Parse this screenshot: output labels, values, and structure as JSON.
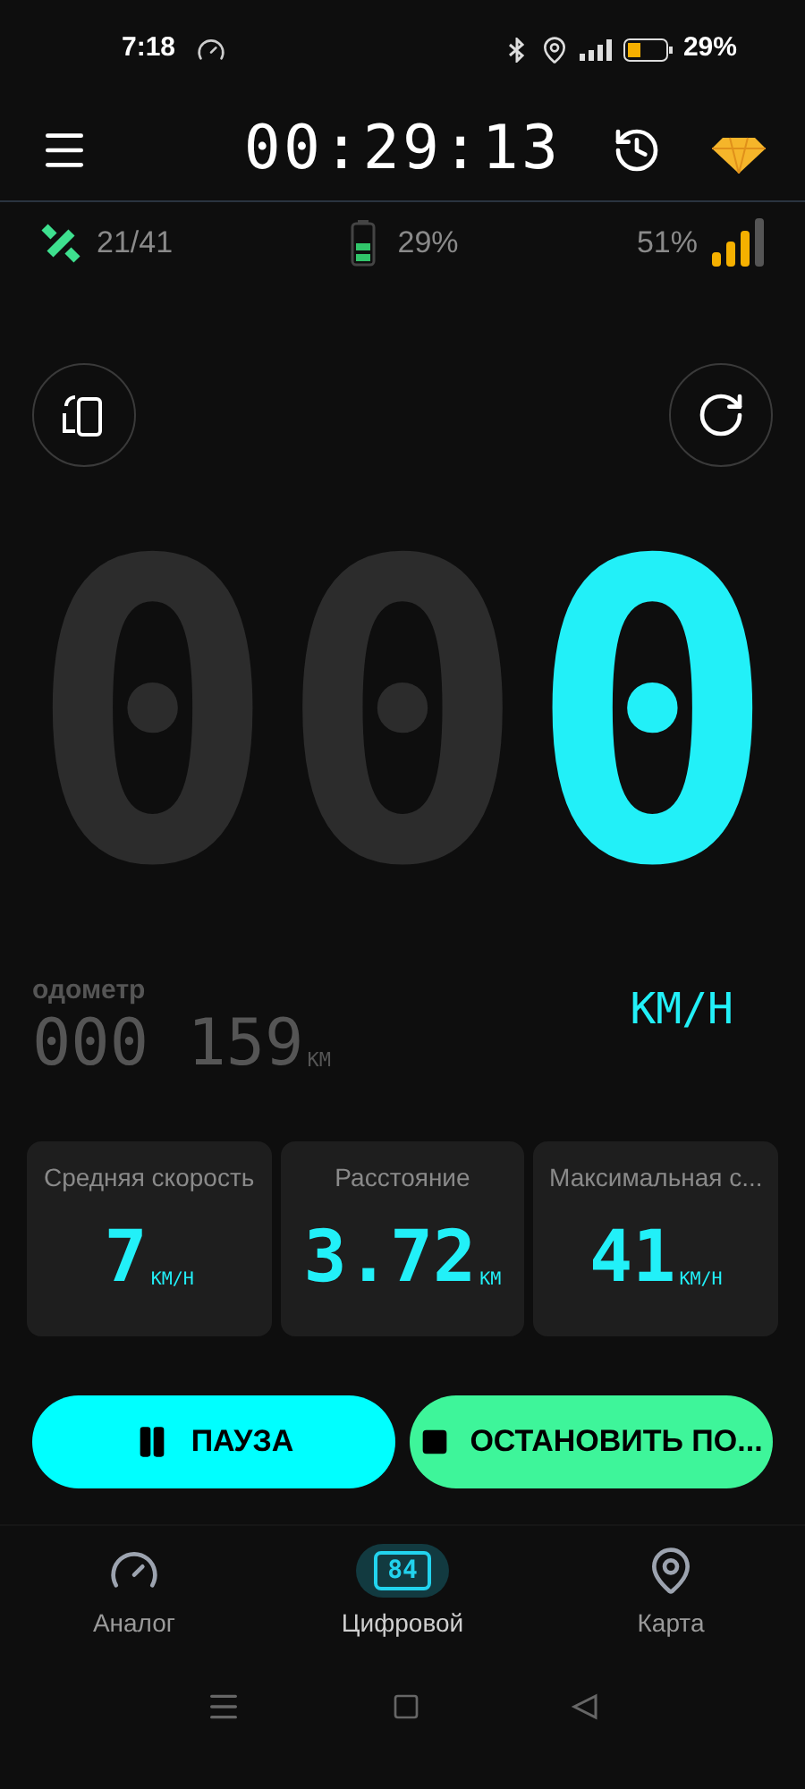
{
  "status_bar": {
    "time": "7:18",
    "battery": "29%"
  },
  "header": {
    "timer": "00:29:13"
  },
  "info": {
    "satellites": "21/41",
    "battery": "29%",
    "signal": "51%"
  },
  "speed": {
    "digits": [
      {
        "digit": "0",
        "lit": false
      },
      {
        "digit": "0",
        "lit": false
      },
      {
        "digit": "0",
        "lit": true
      }
    ],
    "unit": "KM/H"
  },
  "odometer": {
    "label": "одометр",
    "value": "000 159",
    "unit": "KM"
  },
  "stats": [
    {
      "label": "Средняя скорость",
      "value": "7",
      "unit": "KM/H"
    },
    {
      "label": "Расстояние",
      "value": "3.72",
      "unit": "KM"
    },
    {
      "label": "Максимальная с...",
      "value": "41",
      "unit": "KM/H"
    }
  ],
  "buttons": [
    {
      "kind": "pause",
      "label": "ПАУЗА"
    },
    {
      "kind": "stop",
      "label": "ОСТАНОВИТЬ ПО..."
    }
  ],
  "nav": [
    {
      "kind": "gauge",
      "label": "Аналог",
      "selected": false
    },
    {
      "kind": "digital",
      "label": "Цифровой",
      "icon_text": "84",
      "selected": true
    },
    {
      "kind": "map",
      "label": "Карта",
      "selected": false
    }
  ]
}
